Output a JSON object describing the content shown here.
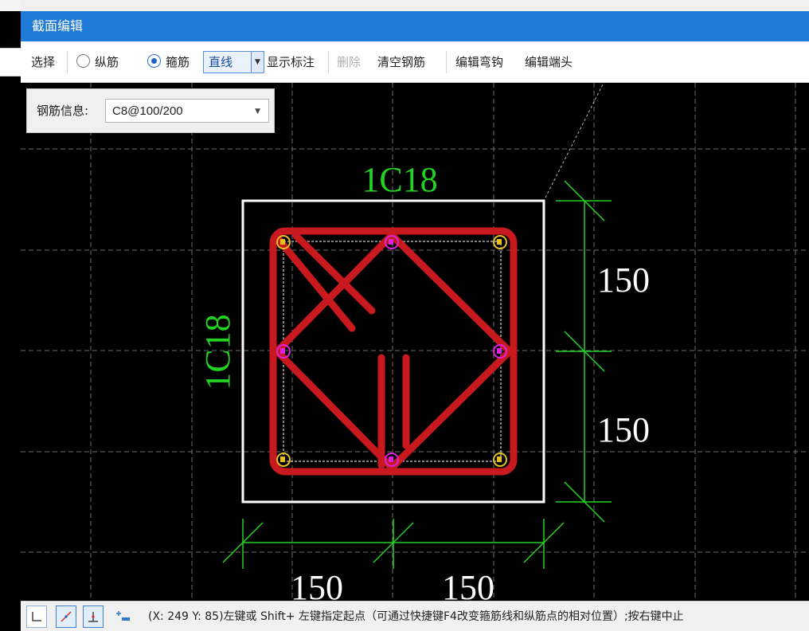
{
  "dialog": {
    "title": "截面编辑"
  },
  "toolbar": {
    "select_label": "选择",
    "longitudinal_label": "纵筋",
    "stirrup_label": "箍筋",
    "draw_mode": "直线",
    "show_annotation": "显示标注",
    "delete_label": "删除",
    "clear_rebar": "清空钢筋",
    "edit_hook": "编辑弯钩",
    "edit_end": "编辑端头",
    "selected_radio": "箍筋"
  },
  "rebar_info": {
    "label": "钢筋信息:",
    "value": "C8@100/200"
  },
  "drawing": {
    "top_label": "1C18",
    "left_label": "1C18",
    "dim_right_upper": "150",
    "dim_right_lower": "150",
    "dim_bottom_left": "150",
    "dim_bottom_right": "150",
    "colors": {
      "stirrup": "#c8191e",
      "dimension": "#22d322",
      "corner_bar": "#e6c020",
      "middle_bar": "#e020e0",
      "outline": "#ffffff"
    }
  },
  "status": {
    "message": "(X: 249 Y: 85)左键或 Shift+ 左键指定起点（可通过快捷键F4改变箍筋线和纵筋点的相对位置）;按右键中止"
  }
}
